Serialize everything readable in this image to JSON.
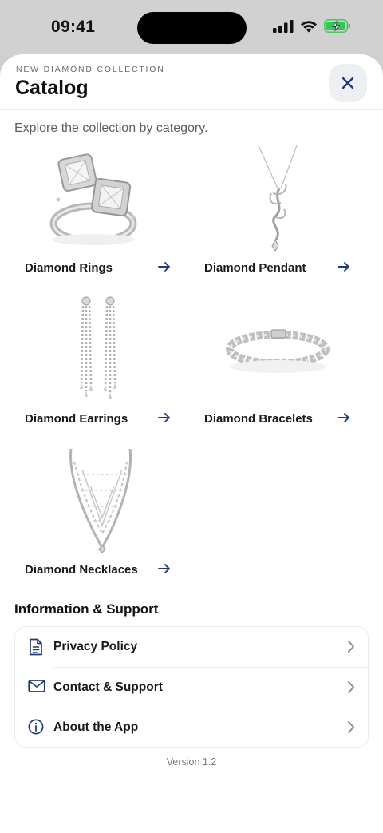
{
  "status_bar": {
    "time": "09:41"
  },
  "header": {
    "eyebrow": "NEW DIAMOND COLLECTION",
    "title": "Catalog"
  },
  "subtitle": "Explore the collection by category.",
  "categories": [
    {
      "label": "Diamond Rings",
      "icon": "ring-image"
    },
    {
      "label": "Diamond Pendant",
      "icon": "pendant-image"
    },
    {
      "label": "Diamond Earrings",
      "icon": "earrings-image"
    },
    {
      "label": "Diamond Bracelets",
      "icon": "bracelet-image"
    },
    {
      "label": "Diamond Necklaces",
      "icon": "necklace-image"
    }
  ],
  "support": {
    "title": "Information & Support",
    "items": [
      {
        "label": "Privacy Policy",
        "icon": "document-icon"
      },
      {
        "label": "Contact & Support",
        "icon": "mail-icon"
      },
      {
        "label": "About the App",
        "icon": "info-icon"
      }
    ]
  },
  "version": "Version 1.2",
  "colors": {
    "accent": "#1f3a78",
    "battery": "#34c759"
  }
}
